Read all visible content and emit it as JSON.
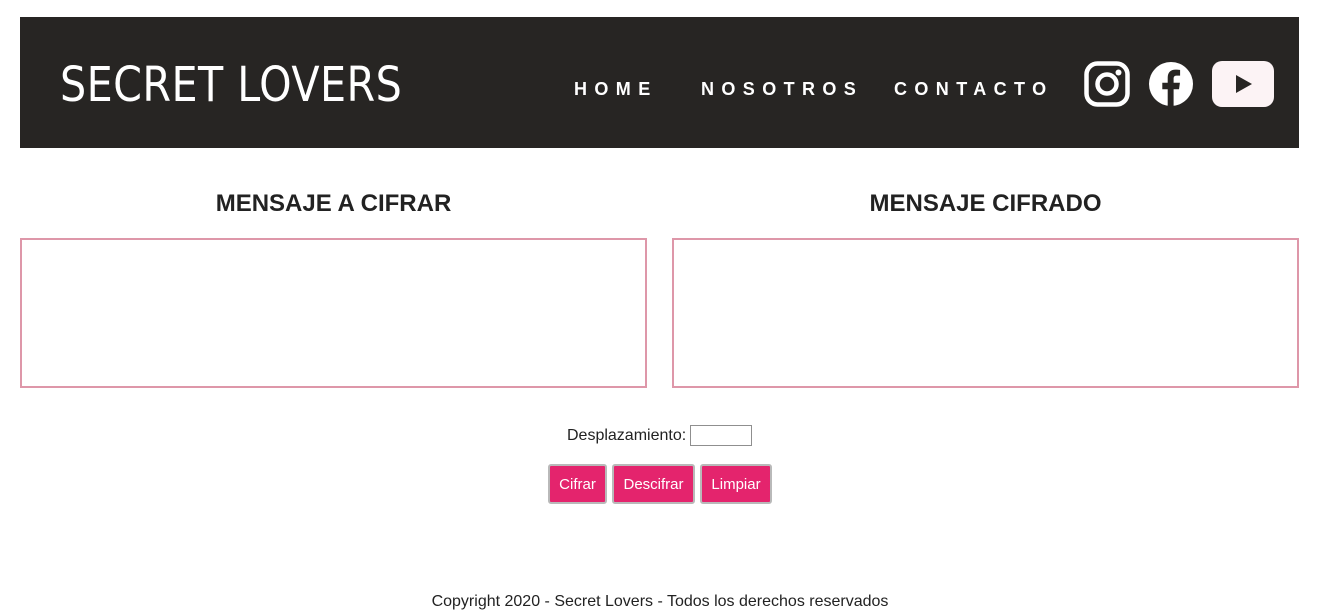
{
  "header": {
    "brand": "SECRET LOVERS",
    "nav": {
      "home": "HOME",
      "nosotros": "NOSOTROS",
      "contacto": "CONTACTO"
    },
    "social_icons": [
      "instagram-icon",
      "facebook-icon",
      "youtube-icon"
    ]
  },
  "main": {
    "left_panel": {
      "title": "MENSAJE A CIFRAR",
      "value": ""
    },
    "right_panel": {
      "title": "MENSAJE CIFRADO",
      "value": ""
    },
    "shift": {
      "label": "Desplazamiento:",
      "value": ""
    },
    "buttons": {
      "cifrar": "Cifrar",
      "descifrar": "Descifrar",
      "limpiar": "Limpiar"
    }
  },
  "footer": {
    "text": "Copyright 2020 - Secret Lovers - Todos los derechos reservados"
  },
  "colors": {
    "header_bg": "#272523",
    "accent": "#e4246d",
    "textarea_border": "#de97a9"
  }
}
